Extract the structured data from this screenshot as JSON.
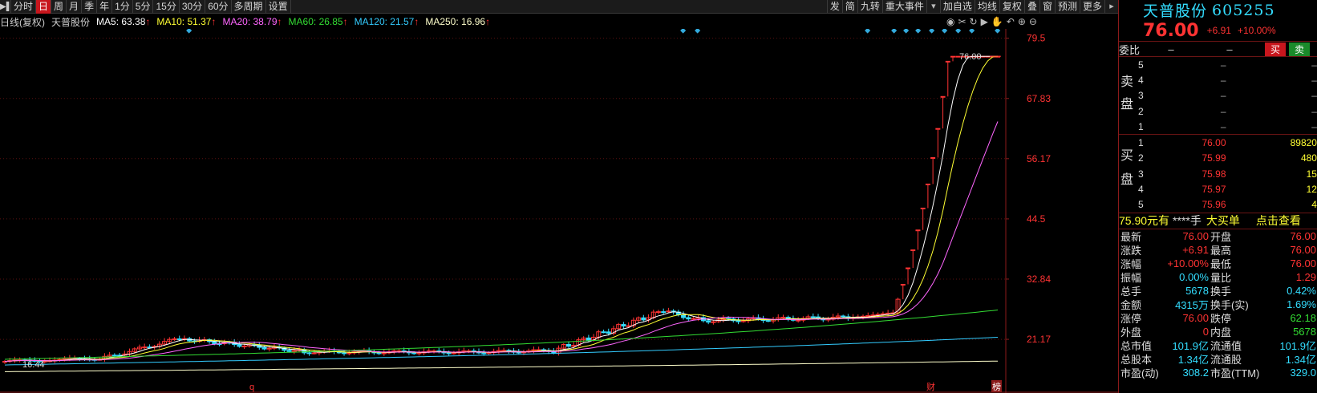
{
  "toolbar": {
    "left": [
      "分时",
      "日",
      "周",
      "月",
      "季",
      "年",
      "1分",
      "5分",
      "15分",
      "30分",
      "60分",
      "多周期",
      "设置"
    ],
    "active": "日",
    "right": [
      "发",
      "简",
      "九转",
      "重大事件",
      "加自选",
      "均线",
      "复权",
      "叠",
      "窗",
      "预测",
      "更多"
    ]
  },
  "ma_legend": {
    "title": "日线(复权)",
    "stock": "天普股份",
    "items": [
      {
        "label": "MA5",
        "value": "63.38",
        "color": "#ffffff"
      },
      {
        "label": "MA10",
        "value": "51.37",
        "color": "#ffff33"
      },
      {
        "label": "MA20",
        "value": "38.79",
        "color": "#ff66ff"
      },
      {
        "label": "MA60",
        "value": "26.85",
        "color": "#33dd33"
      },
      {
        "label": "MA120",
        "value": "21.57",
        "color": "#33ccff"
      },
      {
        "label": "MA250",
        "value": "16.96",
        "color": "#ffffcc"
      }
    ],
    "arrow": "↑"
  },
  "chart_data": {
    "type": "candlestick",
    "y_ticks": [
      79.5,
      67.83,
      56.17,
      44.5,
      32.84,
      21.17
    ],
    "ylim": [
      14.5,
      81.0
    ],
    "last_price_label": "76.00",
    "min_label": "16.44",
    "bottom_markers": [
      "q",
      "财",
      "榜"
    ],
    "colors": {
      "up": "#ff3333",
      "down": "#33ddff",
      "ma5": "#ffffff",
      "ma10": "#ffff33",
      "ma20": "#ff66ff",
      "ma60": "#33dd33",
      "ma120": "#33ccff",
      "ma250": "#ffffcc"
    }
  },
  "panel": {
    "stock_name": "天普股份",
    "code": "605255",
    "price": "76.00",
    "change": "+6.91",
    "pct": "+10.00%",
    "webi": {
      "label": "委比",
      "v1": "–",
      "v2": "–",
      "buy": "买",
      "sell": "卖"
    },
    "sell_label": "卖盘",
    "buy_label": "买盘",
    "sells": [
      {
        "lv": "5",
        "price": "–",
        "vol": "–"
      },
      {
        "lv": "4",
        "price": "–",
        "vol": "–"
      },
      {
        "lv": "3",
        "price": "–",
        "vol": "–"
      },
      {
        "lv": "2",
        "price": "–",
        "vol": "–"
      },
      {
        "lv": "1",
        "price": "–",
        "vol": "–"
      }
    ],
    "buys": [
      {
        "lv": "1",
        "price": "76.00",
        "vol": "89820"
      },
      {
        "lv": "2",
        "price": "75.99",
        "vol": "480"
      },
      {
        "lv": "3",
        "price": "75.98",
        "vol": "15"
      },
      {
        "lv": "4",
        "price": "75.97",
        "vol": "12"
      },
      {
        "lv": "5",
        "price": "75.96",
        "vol": "4"
      }
    ],
    "ad": {
      "p1": "75.90元有",
      "p2": "****手",
      "p3": "大买单",
      "p4": "点击查看"
    },
    "stats": [
      {
        "k1": "最新",
        "v1": "76.00",
        "c1": "red",
        "k2": "开盘",
        "v2": "76.00",
        "c2": "red"
      },
      {
        "k1": "涨跌",
        "v1": "+6.91",
        "c1": "red",
        "k2": "最高",
        "v2": "76.00",
        "c2": "red"
      },
      {
        "k1": "涨幅",
        "v1": "+10.00%",
        "c1": "red",
        "k2": "最低",
        "v2": "76.00",
        "c2": "red"
      },
      {
        "k1": "振幅",
        "v1": "0.00%",
        "c1": "cyan",
        "k2": "量比",
        "v2": "1.29",
        "c2": "red"
      },
      {
        "k1": "总手",
        "v1": "5678",
        "c1": "cyan",
        "k2": "换手",
        "v2": "0.42%",
        "c2": "cyan"
      },
      {
        "k1": "金额",
        "v1": "4315万",
        "c1": "cyan",
        "k2": "换手(实)",
        "v2": "1.69%",
        "c2": "cyan"
      },
      {
        "k1": "涨停",
        "v1": "76.00",
        "c1": "red",
        "k2": "跌停",
        "v2": "62.18",
        "c2": "green"
      },
      {
        "k1": "外盘",
        "v1": "0",
        "c1": "red",
        "k2": "内盘",
        "v2": "5678",
        "c2": "green"
      },
      {
        "k1": "总市值",
        "v1": "101.9亿",
        "c1": "cyan",
        "k2": "流通值",
        "v2": "101.9亿",
        "c2": "cyan"
      },
      {
        "k1": "总股本",
        "v1": "1.34亿",
        "c1": "cyan",
        "k2": "流通股",
        "v2": "1.34亿",
        "c2": "cyan"
      },
      {
        "k1": "市盈(动)",
        "v1": "308.2",
        "c1": "cyan",
        "k2": "市盈(TTM)",
        "v2": "329.0",
        "c2": "cyan"
      }
    ]
  }
}
